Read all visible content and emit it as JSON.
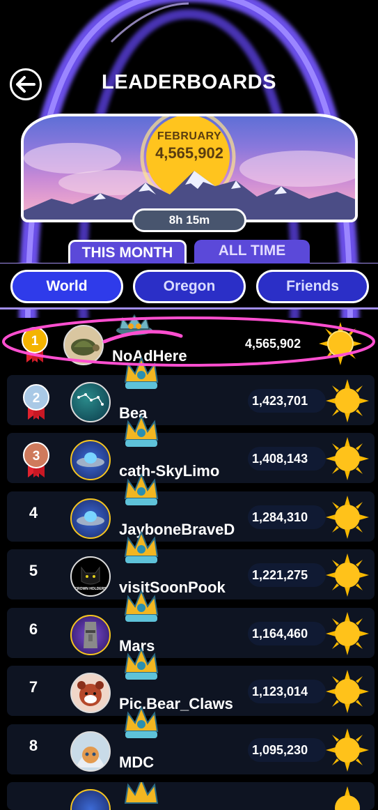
{
  "header": {
    "title": "LEADERBOARDS",
    "back_icon": "back-arrow-icon"
  },
  "banner": {
    "month": "FEBRUARY",
    "month_score": "4,565,902",
    "timer": "8h 15m"
  },
  "tabs": [
    {
      "label": "THIS MONTH",
      "active": true
    },
    {
      "label": "ALL TIME",
      "active": false
    }
  ],
  "filters": [
    {
      "label": "World",
      "selected": true
    },
    {
      "label": "Oregon",
      "selected": false
    },
    {
      "label": "Friends",
      "selected": false
    }
  ],
  "players": [
    {
      "rank": "1",
      "name": "NoAdHere",
      "score": "4,565,902",
      "medal": "gold",
      "avatar": "tortoise"
    },
    {
      "rank": "2",
      "name": "Bea",
      "score": "1,423,701",
      "medal": "silver",
      "avatar": "constellation"
    },
    {
      "rank": "3",
      "name": "cath-SkyLimo",
      "score": "1,408,143",
      "medal": "bronze",
      "avatar": "ufo"
    },
    {
      "rank": "4",
      "name": "JayboneBraveD",
      "score": "1,284,310",
      "medal": "",
      "avatar": "ufo"
    },
    {
      "rank": "5",
      "name": "visitSoonPook",
      "score": "1,221,275",
      "medal": "",
      "avatar": "black-cat",
      "avatar_text": "CROWN HOLDERS"
    },
    {
      "rank": "6",
      "name": "Mars",
      "score": "1,164,460",
      "medal": "",
      "avatar": "moai"
    },
    {
      "rank": "7",
      "name": "Pic.Bear_Claws",
      "score": "1,123,014",
      "medal": "",
      "avatar": "red-panda"
    },
    {
      "rank": "8",
      "name": "MDC",
      "score": "1,095,230",
      "medal": "",
      "avatar": "cat-in-blanket"
    }
  ],
  "colors": {
    "accent": "#5b49d9",
    "filter_selected": "#2f3bea",
    "highlight": "#ff4fd0",
    "sun": "#f7b800"
  }
}
